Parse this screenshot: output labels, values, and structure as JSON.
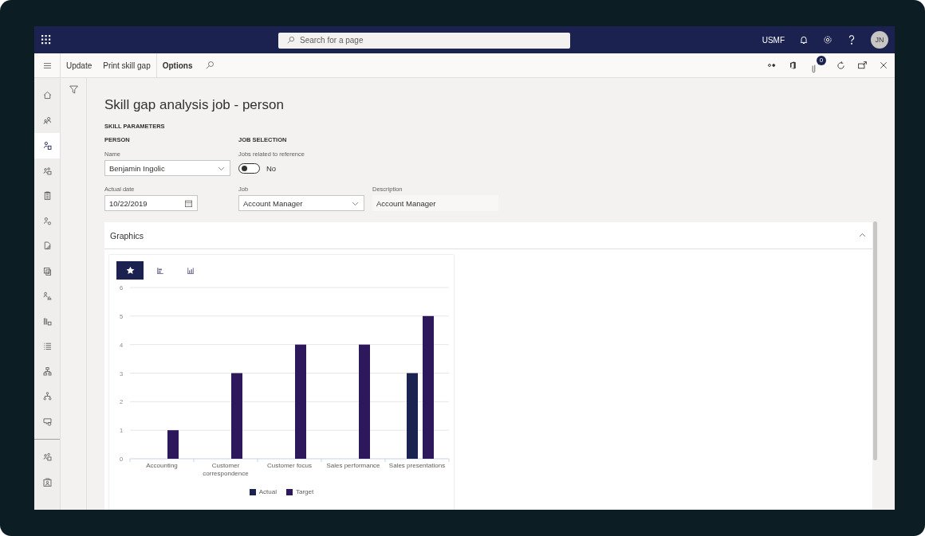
{
  "top_bar": {
    "search": {
      "placeholder": "Search for a page"
    },
    "company": "USMF",
    "avatar": "JN"
  },
  "action_bar": {
    "items": [
      {
        "label": "Update",
        "selected": false
      },
      {
        "label": "Print skill gap",
        "selected": false
      },
      {
        "label": "Options",
        "selected": true
      }
    ],
    "badge": "0"
  },
  "sidebar": {
    "items": [
      {
        "selected": false
      },
      {
        "selected": false
      },
      {
        "selected": true
      },
      {
        "selected": false
      },
      {
        "selected": false
      },
      {
        "selected": false
      },
      {
        "selected": false
      },
      {
        "selected": false
      },
      {
        "selected": false
      },
      {
        "selected": false
      },
      {
        "selected": false
      },
      {
        "selected": false
      },
      {
        "selected": false
      },
      {
        "selected": false
      },
      {
        "selected": false
      },
      {
        "selected": false
      }
    ]
  },
  "page": {
    "title": "Skill gap analysis job - person",
    "section": "SKILL PARAMETERS",
    "person": {
      "heading": "PERSON",
      "name": {
        "label": "Name",
        "value": "Benjamin Ingolic"
      },
      "date": {
        "label": "Actual date",
        "value": "10/22/2019"
      }
    },
    "job_selection": {
      "heading": "JOB SELECTION",
      "toggle": {
        "label": "Jobs related to reference",
        "on": false,
        "value": "No"
      },
      "job": {
        "label": "Job",
        "value": "Account Manager"
      },
      "description": {
        "label": "Description",
        "value": "Account Manager"
      }
    }
  },
  "graphics": {
    "title": "Graphics",
    "expanded": true,
    "views": [
      {
        "selected": true
      },
      {
        "selected": false
      },
      {
        "selected": false
      }
    ],
    "chart_data": {
      "type": "bar",
      "grid": true,
      "legend": true,
      "categories": [
        "Accounting",
        "Customer correspondence",
        "Customer focus",
        "Sales performance",
        "Sales presentations"
      ],
      "ylim": [
        0,
        6
      ],
      "yticks": [
        0,
        1,
        2,
        3,
        4,
        5,
        6
      ],
      "series": [
        {
          "name": "Actual",
          "color": "#1b2350",
          "values": [
            0,
            0,
            0,
            0,
            3
          ]
        },
        {
          "name": "Target",
          "color": "#2c185a",
          "values": [
            1,
            3,
            4,
            4,
            5
          ]
        }
      ]
    }
  }
}
